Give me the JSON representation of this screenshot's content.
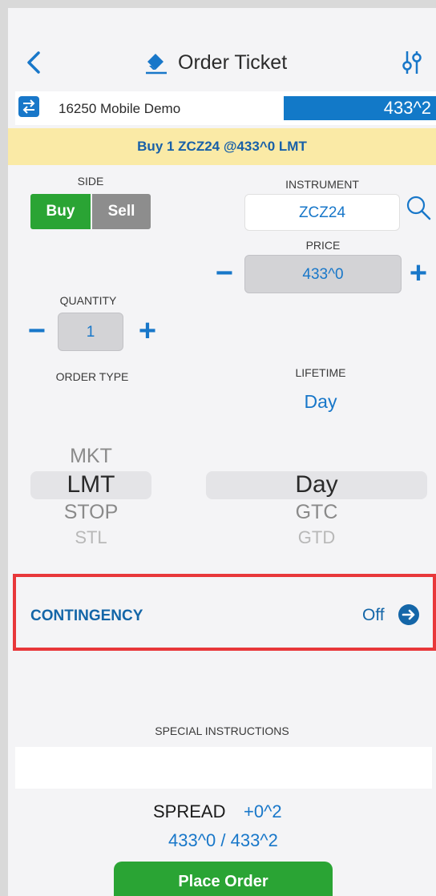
{
  "header": {
    "title": "Order Ticket",
    "back_icon": "chevron-left-icon",
    "title_icon": "eraser-icon",
    "settings_icon": "sliders-icon"
  },
  "account": {
    "icon": "swap-arrows-icon",
    "name": "16250 Mobile Demo",
    "price": "433^2"
  },
  "summary": "Buy 1 ZCZ24 @433^0 LMT",
  "side": {
    "label": "SIDE",
    "buy": "Buy",
    "sell": "Sell",
    "selected": "Buy"
  },
  "instrument": {
    "label": "INSTRUMENT",
    "value": "ZCZ24",
    "search_icon": "search-icon"
  },
  "price": {
    "label": "PRICE",
    "value": "433^0",
    "minus": "−",
    "plus": "+"
  },
  "quantity": {
    "label": "QUANTITY",
    "value": "1",
    "minus": "−",
    "plus": "+"
  },
  "order_type": {
    "label": "ORDER TYPE",
    "options": [
      "MKT",
      "LMT",
      "STOP",
      "STL"
    ],
    "selected": "LMT"
  },
  "lifetime": {
    "label": "LIFETIME",
    "value": "Day",
    "options": [
      "Day",
      "GTC",
      "GTD"
    ],
    "selected": "Day"
  },
  "contingency": {
    "label": "CONTINGENCY",
    "value": "Off",
    "arrow_icon": "arrow-right-circle-icon"
  },
  "special_instructions": {
    "label": "SPECIAL INSTRUCTIONS",
    "value": ""
  },
  "spread": {
    "label": "SPREAD",
    "value": "+0^2",
    "bid_ask": "433^0 / 433^2"
  },
  "place_order": "Place Order",
  "colors": {
    "accent_blue": "#1877c9",
    "buy_green": "#2aa434",
    "sell_gray": "#8d8d8d",
    "summary_bg": "#faeaa6",
    "price_bar": "#1279c8",
    "highlight_red": "#e8373a"
  }
}
